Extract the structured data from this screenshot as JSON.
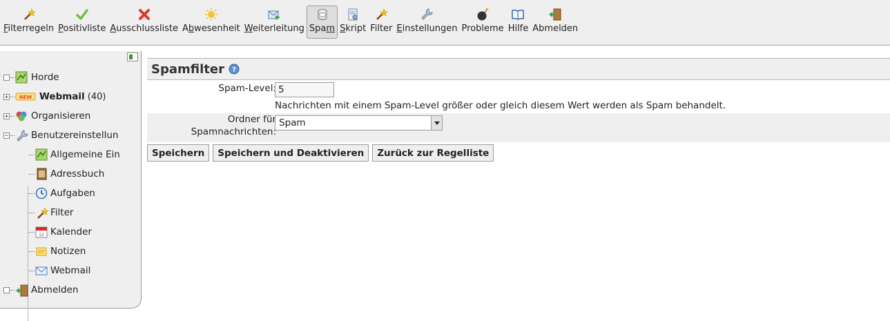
{
  "toolbar": {
    "items": [
      {
        "label": "Filterregeln",
        "underline": "F",
        "rest": "ilterregeln",
        "icon": "wand-icon"
      },
      {
        "label": "Positivliste",
        "underline": "P",
        "rest": "ositivliste",
        "icon": "checkmark-icon"
      },
      {
        "label": "Ausschlussliste",
        "underline": "A",
        "rest": "usschlussliste",
        "icon": "x-icon"
      },
      {
        "label": "Abwesenheit",
        "pre": "A",
        "underline": "b",
        "rest": "wesenheit",
        "icon": "sun-icon"
      },
      {
        "label": "Weiterleitung",
        "underline": "W",
        "rest": "eiterleitung",
        "icon": "forward-mail-icon"
      },
      {
        "label": "Spam",
        "pre": "Spa",
        "underline": "m",
        "rest": "",
        "icon": "spam-can-icon",
        "active": true
      },
      {
        "label": "Skript",
        "underline": "S",
        "rest": "kript",
        "icon": "script-icon"
      },
      {
        "label": "Filter",
        "pre": "",
        "underline": "",
        "rest": "Filter",
        "icon": "wand-icon"
      },
      {
        "label": "Einstellungen",
        "underline": "E",
        "rest": "instellungen",
        "icon": "wrench-icon"
      },
      {
        "label": "Probleme",
        "pre": "",
        "underline": "",
        "rest": "Probleme",
        "icon": "bomb-icon"
      },
      {
        "label": "Hilfe",
        "pre": "",
        "underline": "",
        "rest": "Hilfe",
        "icon": "book-icon"
      },
      {
        "label": "Abmelden",
        "pre": "",
        "underline": "",
        "rest": "Abmelden",
        "icon": "logout-door-icon"
      }
    ]
  },
  "sidebar": {
    "items": [
      {
        "label": "Horde",
        "icon": "horde-map-icon",
        "expander": "□"
      },
      {
        "label": "Webmail",
        "count": "(40)",
        "icon": "new-mail-icon",
        "expander": "+",
        "bold": true
      },
      {
        "label": "Organisieren",
        "icon": "organize-icon",
        "expander": "+"
      },
      {
        "label": "Benutzereinstellun",
        "icon": "wrench-icon",
        "expander": "−"
      },
      {
        "label": "Allgemeine Ein",
        "icon": "horde-map-icon",
        "child": true
      },
      {
        "label": "Adressbuch",
        "icon": "addressbook-icon",
        "child": true
      },
      {
        "label": "Aufgaben",
        "icon": "clock-icon",
        "child": true
      },
      {
        "label": "Filter",
        "icon": "wand-icon",
        "child": true
      },
      {
        "label": "Kalender",
        "icon": "calendar-icon",
        "child": true
      },
      {
        "label": "Notizen",
        "icon": "notes-icon",
        "child": true
      },
      {
        "label": "Webmail",
        "icon": "mail-icon",
        "child": true
      },
      {
        "label": "Abmelden",
        "icon": "logout-door-icon",
        "expander": "□"
      }
    ]
  },
  "main": {
    "title": "Spamfilter",
    "spam_level_label": "Spam-Level:",
    "spam_level_value": "5",
    "spam_level_description": "Nachrichten mit einem Spam-Level größer oder gleich diesem Wert werden als Spam behandelt.",
    "folder_label_line1": "Ordner für",
    "folder_label_line2": "Spamnachrichten:",
    "folder_value": "Spam",
    "buttons": {
      "save": "Speichern",
      "save_deactivate": "Speichern und Deaktivieren",
      "back": "Zurück zur Regelliste"
    }
  }
}
